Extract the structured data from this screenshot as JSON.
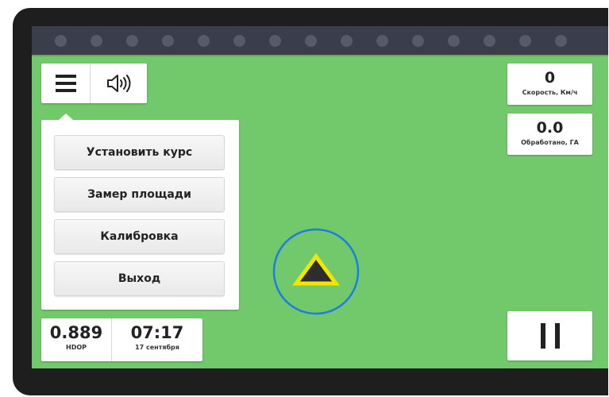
{
  "colors": {
    "field": "#72c96b",
    "led_bar": "#3a3d4a",
    "ring": "#1a7fe0",
    "marker_border": "#f2e600",
    "marker_fill": "#2d2d2d"
  },
  "toolbar": {
    "menu_icon": "hamburger-icon",
    "sound_icon": "speaker-icon"
  },
  "led_count": 15,
  "menu": {
    "items": [
      {
        "label": "Установить курс"
      },
      {
        "label": "Замер площади"
      },
      {
        "label": "Калибровка"
      },
      {
        "label": "Выход"
      }
    ]
  },
  "status": {
    "hdop_value": "0.889",
    "hdop_label": "HDOP",
    "time": "07:17",
    "date": "17 сентября"
  },
  "speed": {
    "value": "0",
    "label": "Скорость, Км/ч"
  },
  "area": {
    "value": "0.0",
    "label": "Обработано, ГА"
  },
  "pause_icon": "pause-icon",
  "marker_icon": "position-marker-icon"
}
